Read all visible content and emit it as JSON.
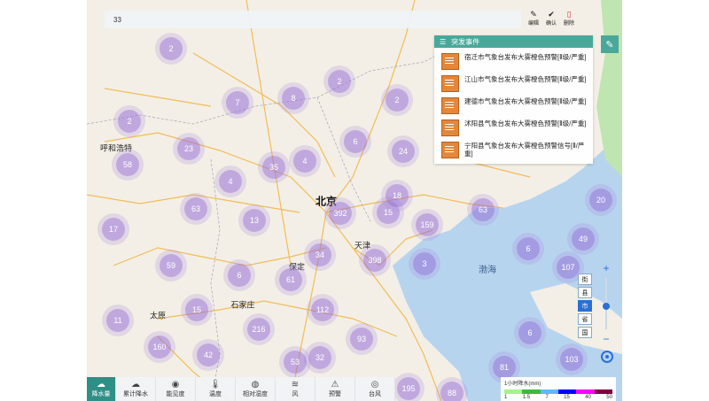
{
  "topbar": {
    "text": "33"
  },
  "top_actions": [
    {
      "label": "编辑",
      "icon": "edit-icon"
    },
    {
      "label": "确认",
      "icon": "check-icon"
    },
    {
      "label": "删除",
      "icon": "trash-icon"
    }
  ],
  "panel": {
    "title": "突发事件",
    "items": [
      {
        "text": "宿迁市气象台发布大雾橙色预警[Ⅱ级/严重]"
      },
      {
        "text": "江山市气象台发布大雾橙色预警[Ⅱ级/严重]"
      },
      {
        "text": "建德市气象台发布大雾橙色预警[Ⅱ级/严重]"
      },
      {
        "text": "沭阳县气象台发布大雾橙色预警[Ⅱ级/严重]"
      },
      {
        "text": "宁阳县气象台发布大雾橙色预警信号[Ⅱ/严重]"
      }
    ]
  },
  "map": {
    "clusters": [
      "2",
      "2",
      "2",
      "7",
      "8",
      "2",
      "4",
      "58",
      "23",
      "6",
      "24",
      "35",
      "4",
      "15",
      "63",
      "13",
      "392",
      "18",
      "159",
      "17",
      "6",
      "20",
      "63",
      "49",
      "59",
      "34",
      "398",
      "3",
      "6",
      "61",
      "107",
      "11",
      "15",
      "112",
      "32",
      "216",
      "93",
      "6",
      "160",
      "42",
      "53",
      "103",
      "81",
      "195",
      "88"
    ],
    "cities": [
      "呼和浩特",
      "北京",
      "天津",
      "石家庄",
      "太原",
      "保定",
      "渤海"
    ],
    "sea_label": "渤海"
  },
  "zoom": {
    "plus": "+",
    "minus": "−",
    "level": 0.5
  },
  "levels": [
    {
      "label": "街",
      "active": false
    },
    {
      "label": "县",
      "active": false
    },
    {
      "label": "市",
      "active": true
    },
    {
      "label": "省",
      "active": false
    },
    {
      "label": "国",
      "active": false
    }
  ],
  "legend": {
    "title": "1小时降水(mm)",
    "ticks": [
      "1",
      "1.5",
      "7",
      "15",
      "40",
      "50"
    ],
    "colors": [
      "#a6f28f",
      "#3dba3d",
      "#61b8ff",
      "#0000fe",
      "#fa00fa",
      "#800040"
    ]
  },
  "toolbar": [
    {
      "label": "降水量",
      "icon": "rain-cloud-icon",
      "active": true
    },
    {
      "label": "累计降水",
      "icon": "cloud-icon",
      "active": false
    },
    {
      "label": "能见度",
      "icon": "eye-icon",
      "active": false
    },
    {
      "label": "温度",
      "icon": "thermometer-icon",
      "active": false
    },
    {
      "label": "相对湿度",
      "icon": "droplet-icon",
      "active": false
    },
    {
      "label": "风",
      "icon": "wind-icon",
      "active": false
    },
    {
      "label": "预警",
      "icon": "warning-icon",
      "active": false
    },
    {
      "label": "台风",
      "icon": "typhoon-icon",
      "active": false
    }
  ]
}
